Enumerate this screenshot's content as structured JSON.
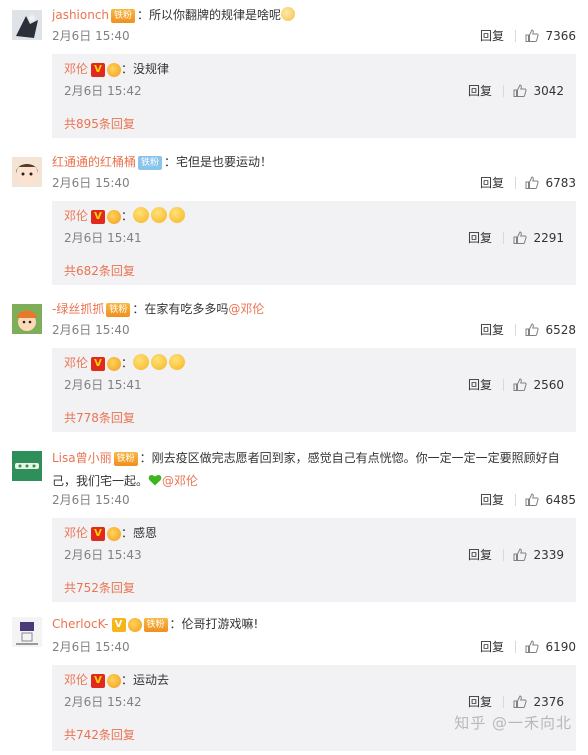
{
  "comments": [
    {
      "user": "jashionch",
      "badge": "铁粉",
      "text": "：所以你翻牌的规律是啥呢",
      "time": "2月6日 15:40",
      "reply": "回复",
      "likes": "7366",
      "sub": {
        "user": "邓伦",
        "text": "：没规律",
        "time": "2月6日 15:42",
        "reply": "回复",
        "likes": "3042"
      },
      "more": "共895条回复"
    },
    {
      "user": "红通通的红桶桶",
      "badge": "铁粉",
      "text": "：宅但是也要运动！",
      "time": "2月6日 15:40",
      "reply": "回复",
      "likes": "6783",
      "sub": {
        "user": "邓伦",
        "text": "：",
        "time": "2月6日 15:41",
        "reply": "回复",
        "likes": "2291"
      },
      "more": "共682条回复"
    },
    {
      "user": "-绿丝抓抓",
      "badge": "铁粉",
      "text": "：在家有吃多多吗",
      "mention": "@邓伦",
      "time": "2月6日 15:40",
      "reply": "回复",
      "likes": "6528",
      "sub": {
        "user": "邓伦",
        "text": "：",
        "time": "2月6日 15:41",
        "reply": "回复",
        "likes": "2560"
      },
      "more": "共778条回复"
    },
    {
      "user": "Lisa曾小丽",
      "badge": "铁粉",
      "text": "：刚去疫区做完志愿者回到家，感觉自己有点恍惚。你一定一定一定要照顾好自己，我们宅一起。",
      "mention": "@邓伦",
      "time": "2月6日 15:40",
      "reply": "回复",
      "likes": "6485",
      "sub": {
        "user": "邓伦",
        "text": "：感恩",
        "time": "2月6日 15:43",
        "reply": "回复",
        "likes": "2339"
      },
      "more": "共752条回复"
    },
    {
      "user": "CherlocK-",
      "badge": "铁粉",
      "text": "：伦哥打游戏嘛!",
      "time": "2月6日 15:40",
      "reply": "回复",
      "likes": "6190",
      "sub": {
        "user": "邓伦",
        "text": "：运动去",
        "time": "2月6日 15:42",
        "reply": "回复",
        "likes": "2376"
      },
      "more": "共742条回复"
    }
  ],
  "vip_badge": "V",
  "watermark": "知乎 @一禾向北",
  "accent": "#eb7350"
}
